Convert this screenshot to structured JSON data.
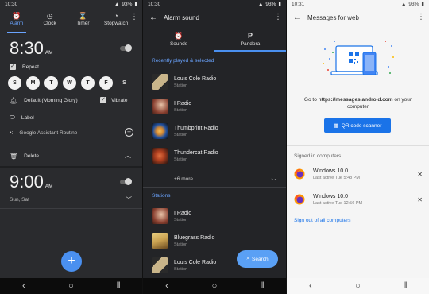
{
  "clock_app": {
    "status": {
      "time": "10:30",
      "battery": "93%"
    },
    "tabs": [
      {
        "label": "Alarm",
        "icon": "alarm-icon",
        "active": true
      },
      {
        "label": "Clock",
        "icon": "clock-icon"
      },
      {
        "label": "Timer",
        "icon": "hourglass-icon"
      },
      {
        "label": "Stopwatch",
        "icon": "stopwatch-icon"
      }
    ],
    "alarm1": {
      "time": "8:30",
      "ampm": "AM",
      "enabled": false,
      "repeat_label": "Repeat",
      "days": [
        "S",
        "M",
        "T",
        "W",
        "T",
        "F",
        "S"
      ],
      "sound_label": "Default (Morning Glory)",
      "vibrate_label": "Vibrate",
      "label_label": "Label",
      "assistant_label": "Google Assistant Routine",
      "delete_label": "Delete"
    },
    "alarm2": {
      "time": "9:00",
      "ampm": "AM",
      "enabled": false,
      "days_summary": "Sun, Sat"
    },
    "fab_label": "+"
  },
  "alarm_sound": {
    "status": {
      "time": "10:30",
      "battery": "93%"
    },
    "title": "Alarm sound",
    "tabs": [
      {
        "label": "Sounds",
        "icon": "alarm-icon"
      },
      {
        "label": "Pandora",
        "icon": "pandora-icon",
        "active": true
      }
    ],
    "recent_header": "Recently played & selected",
    "recent": [
      {
        "name": "Louis Cole Radio",
        "subtitle": "Station",
        "color": "#c9b58a"
      },
      {
        "name": "I Radio",
        "subtitle": "Station",
        "color": "#8a4030"
      },
      {
        "name": "Thumbprint Radio",
        "subtitle": "Station",
        "color": "#d88a30"
      },
      {
        "name": "Thundercat Radio",
        "subtitle": "Station",
        "color": "#b04020"
      }
    ],
    "more_label": "+6 more",
    "stations_header": "Stations",
    "stations": [
      {
        "name": "I Radio",
        "subtitle": "Station",
        "color": "#8a4030"
      },
      {
        "name": "Bluegrass Radio",
        "subtitle": "Station",
        "color": "#c8a050"
      },
      {
        "name": "Louis Cole Radio",
        "subtitle": "Station",
        "color": "#c9b58a"
      }
    ],
    "search_label": "Search"
  },
  "messages_web": {
    "status": {
      "time": "10:31",
      "battery": "93%"
    },
    "title": "Messages for web",
    "desc_prefix": "Go to",
    "desc_url": "https://messages.android.com",
    "desc_suffix": "on your computer",
    "qr_button": "QR code scanner",
    "signed_in_header": "Signed in computers",
    "computers": [
      {
        "name": "Windows 10.0",
        "last_active": "Last active Tue 5:48 PM"
      },
      {
        "name": "Windows 10.0",
        "last_active": "Last active Tue 12:56 PM"
      }
    ],
    "sign_out": "Sign out of all computers",
    "accent": "#1a73e8"
  }
}
